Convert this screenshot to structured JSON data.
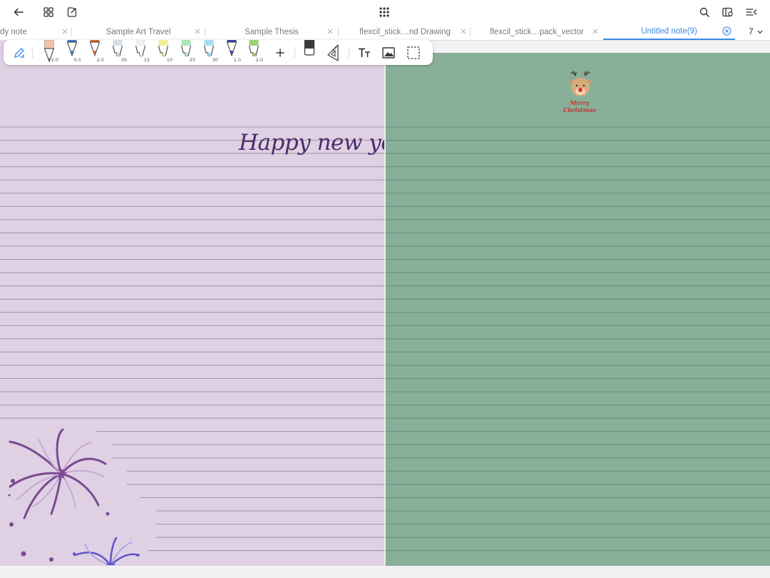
{
  "topbar": {
    "icons": [
      "back-arrow-icon",
      "grid-view-icon",
      "export-icon",
      "apps-menu-icon",
      "search-icon",
      "page-settings-icon",
      "collapse-menu-icon"
    ]
  },
  "tabs": [
    {
      "label": "dy note",
      "active": false
    },
    {
      "label": "Sample Art Travel",
      "active": false
    },
    {
      "label": "Sample Thesis",
      "active": false
    },
    {
      "label": "flexcil_stick…nd Drawing",
      "active": false
    },
    {
      "label": "flexcil_stick…pack_vector",
      "active": false
    },
    {
      "label": "Untitled note(9)",
      "active": true
    }
  ],
  "tab_overflow": {
    "count": "7"
  },
  "toolbar": {
    "pens": [
      {
        "size": "2.0",
        "color": "#f3c3a8",
        "type": "pencil"
      },
      {
        "size": "0.5",
        "color": "#3a79c9",
        "type": "pen"
      },
      {
        "size": "2.0",
        "color": "#d46a2e",
        "type": "pen"
      },
      {
        "size": "30",
        "color": "#d6dbe8",
        "type": "highlighter"
      },
      {
        "size": "15",
        "color": "#eeeeee",
        "type": "highlighter"
      },
      {
        "size": "10",
        "color": "#f3ec9a",
        "type": "highlighter"
      },
      {
        "size": "25",
        "color": "#a8e7b8",
        "type": "highlighter"
      },
      {
        "size": "30",
        "color": "#a8ddf0",
        "type": "highlighter"
      },
      {
        "size": "1.0",
        "color": "#3c41a8",
        "type": "pen"
      },
      {
        "size": "2.0",
        "color": "#9bd27b",
        "type": "highlighter"
      }
    ],
    "icons": [
      "pen-mode-icon",
      "add-pen-icon",
      "eraser-icon",
      "ruler-icon",
      "text-tool-icon",
      "image-tool-icon",
      "lasso-select-icon"
    ]
  },
  "note": {
    "left_page_title": "Happy new year",
    "left_page_color": "#dfd1e3",
    "right_page_color": "#88af98",
    "line_color_left": "#a797a8",
    "line_color_right": "#6e8e7a",
    "sticker_text": [
      "Merry",
      "Christmas"
    ]
  }
}
